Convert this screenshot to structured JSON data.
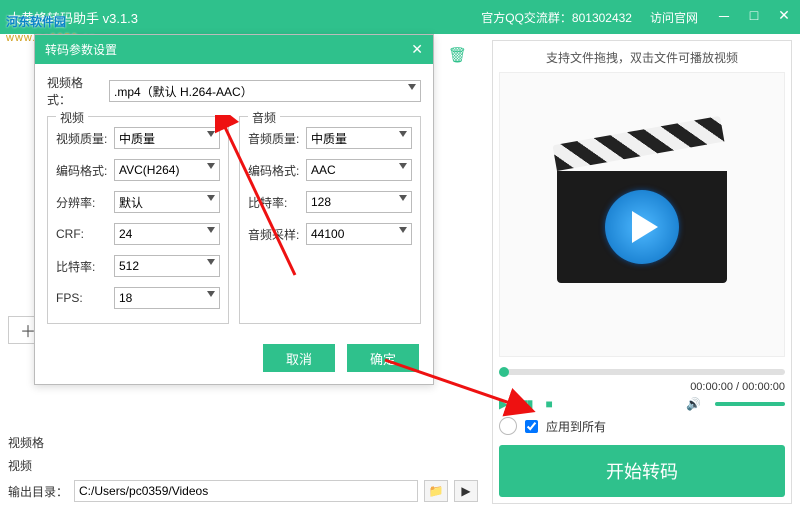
{
  "app": {
    "title": "大黄蜂转码助手 v3.1.3"
  },
  "header": {
    "qq_label": "官方QQ交流群：801302432",
    "site_label": "访问官网"
  },
  "watermark": {
    "name": "河东软件园",
    "url": "www.pc0359.cn"
  },
  "preview": {
    "hint": "支持文件拖拽，双击文件可播放视频",
    "time": "00:00:00 / 00:00:00"
  },
  "apply": {
    "label": "应用到所有",
    "checked": true
  },
  "start_button": "开始转码",
  "bottom": {
    "video_fmt_label": "视频格",
    "video_label": "视频",
    "output_label": "输出目录：",
    "output_path": "C:/Users/pc0359/Videos"
  },
  "dialog": {
    "title": "转码参数设置",
    "format_label": "视频格式：",
    "format_value": ".mp4（默认 H.264-AAC）",
    "video_legend": "视频",
    "audio_legend": "音频",
    "video": {
      "quality_label": "视频质量:",
      "quality_value": "中质量",
      "codec_label": "编码格式:",
      "codec_value": "AVC(H264)",
      "res_label": "分辨率:",
      "res_value": "默认",
      "crf_label": "CRF:",
      "crf_value": "24",
      "bitrate_label": "比特率:",
      "bitrate_value": "512",
      "fps_label": "FPS:",
      "fps_value": "18"
    },
    "audio": {
      "quality_label": "音频质量:",
      "quality_value": "中质量",
      "codec_label": "编码格式:",
      "codec_value": "AAC",
      "bitrate_label": "比特率:",
      "bitrate_value": "128",
      "sample_label": "音频采样:",
      "sample_value": "44100"
    },
    "cancel": "取消",
    "ok": "确定"
  }
}
